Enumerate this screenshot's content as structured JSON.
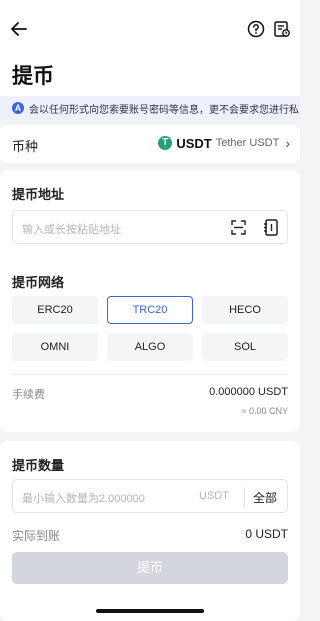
{
  "header": {
    "back_icon": "arrow-left-icon",
    "help_icon": "question-circle-icon",
    "record_icon": "record-list-icon"
  },
  "page": {
    "title": "提币"
  },
  "notice": {
    "icon": "info-icon",
    "icon_text": "A",
    "text": "会以任何形式向您索要账号密码等信息，更不会要求您进行私"
  },
  "coin": {
    "label": "币种",
    "symbol": "USDT",
    "name": "Tether USDT",
    "tether_glyph": "T",
    "chevron": "›"
  },
  "address": {
    "label": "提币地址",
    "placeholder": "输入或长按粘贴地址"
  },
  "network": {
    "label": "提币网络",
    "options": [
      "ERC20",
      "TRC20",
      "HECO",
      "OMNI",
      "ALGO",
      "SOL"
    ],
    "selected": "TRC20"
  },
  "fee": {
    "label": "手续费",
    "value": "0.000000 USDT",
    "cny": "≈ 0.00 CNY"
  },
  "amount": {
    "label": "提币数量",
    "placeholder": "最小输入数量为2.000000",
    "unit": "USDT",
    "all_label": "全部"
  },
  "receive": {
    "label": "实际到账",
    "value": "0 USDT"
  },
  "submit": {
    "label": "提币"
  },
  "colors": {
    "accent": "#3d65d8",
    "tether": "#26a17b",
    "disabled_button": "#d3d6dc"
  }
}
